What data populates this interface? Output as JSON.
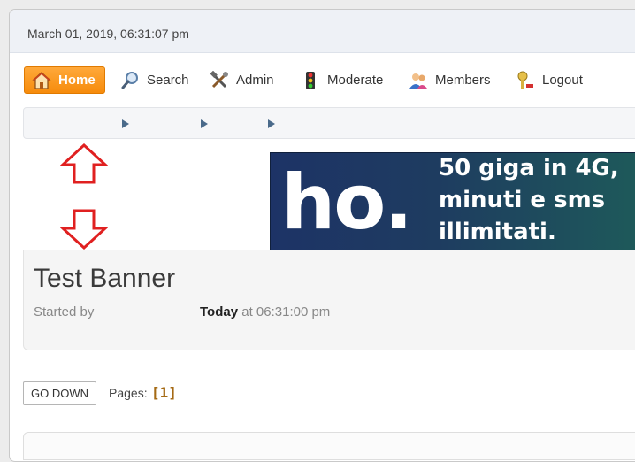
{
  "header": {
    "date": "March 01, 2019, 06:31:07 pm"
  },
  "nav": {
    "items": [
      {
        "label": "Home",
        "icon": "home-icon",
        "active": true
      },
      {
        "label": "Search",
        "icon": "search-icon"
      },
      {
        "label": "Admin",
        "icon": "tools-icon"
      },
      {
        "label": "Moderate",
        "icon": "traffic-light-icon"
      },
      {
        "label": "Members",
        "icon": "members-icon"
      },
      {
        "label": "Logout",
        "icon": "key-icon"
      }
    ]
  },
  "breadcrumb": {
    "separator": "▶",
    "items": [
      "",
      "",
      ""
    ]
  },
  "banner": {
    "logo": "ho.",
    "lines": [
      "50 giga in 4G,",
      "minuti e sms",
      "illimitati."
    ]
  },
  "topic": {
    "title": "Test Banner",
    "started_by_label": "Started by",
    "date_strong": "Today",
    "time": "at 06:31:00 pm"
  },
  "pagination": {
    "go_down_label": "GO DOWN",
    "pages_label": "Pages:",
    "current_page": "[1]"
  },
  "colors": {
    "accent": "#f68b0c",
    "arrow": "#e02020",
    "banner_bg": "#1e3c60",
    "page_link": "#a56a14"
  }
}
